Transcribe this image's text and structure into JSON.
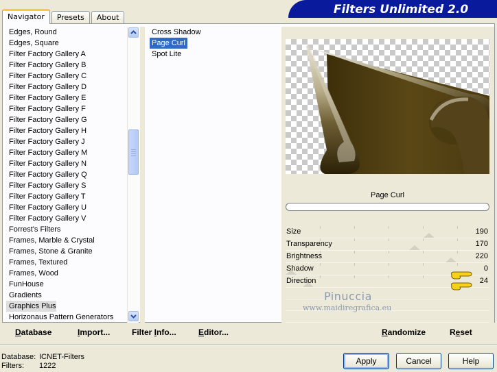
{
  "tabs": [
    {
      "label": "Navigator",
      "active": true
    },
    {
      "label": "Presets",
      "active": false
    },
    {
      "label": "About",
      "active": false
    }
  ],
  "banner": {
    "title": "Filters Unlimited 2.0"
  },
  "categories": {
    "items": [
      "Edges, Round",
      "Edges, Square",
      "Filter Factory Gallery A",
      "Filter Factory Gallery B",
      "Filter Factory Gallery C",
      "Filter Factory Gallery D",
      "Filter Factory Gallery E",
      "Filter Factory Gallery F",
      "Filter Factory Gallery G",
      "Filter Factory Gallery H",
      "Filter Factory Gallery J",
      "Filter Factory Gallery M",
      "Filter Factory Gallery N",
      "Filter Factory Gallery Q",
      "Filter Factory Gallery S",
      "Filter Factory Gallery T",
      "Filter Factory Gallery U",
      "Filter Factory Gallery V",
      "Forrest's Filters",
      "Frames, Marble & Crystal",
      "Frames, Stone & Granite",
      "Frames, Textured",
      "Frames, Wood",
      "FunHouse",
      "Gradients",
      "Graphics Plus",
      "Horizonaus Pattern Generators"
    ],
    "selected": "Graphics Plus"
  },
  "filters": {
    "items": [
      "Cross Shadow",
      "Page Curl",
      "Spot Lite"
    ],
    "selected": "Page Curl"
  },
  "preview": {
    "filter_name": "Page Curl",
    "progress": 0
  },
  "parameters": [
    {
      "label": "Size",
      "value": "190",
      "level": 190
    },
    {
      "label": "Transparency",
      "value": "170",
      "level": 170
    },
    {
      "label": "Brightness",
      "value": "220",
      "level": 220
    },
    {
      "label": "Shadow",
      "value": "0",
      "level": 0
    },
    {
      "label": "Direction",
      "value": "24",
      "level": 24
    }
  ],
  "watermark": {
    "name": "Pinuccia",
    "site": "www.maidiregrafica.eu"
  },
  "toolbar": {
    "database": {
      "pre": "",
      "u": "D",
      "post": "atabase"
    },
    "import": {
      "pre": "",
      "u": "I",
      "post": "mport..."
    },
    "filterinfo": {
      "pre": "Filter ",
      "u": "I",
      "post": "nfo..."
    },
    "editor": {
      "pre": "",
      "u": "E",
      "post": "ditor..."
    },
    "randomize": {
      "pre": "",
      "u": "R",
      "post": "andomize"
    },
    "reset": {
      "pre": "R",
      "u": "e",
      "post": "set"
    }
  },
  "status": {
    "database_label": "Database:",
    "database_value": "ICNET-Filters",
    "filters_label": "Filters:",
    "filters_value": "1222"
  },
  "buttons": {
    "apply": "Apply",
    "cancel": "Cancel",
    "help": "Help"
  },
  "colors": {
    "selection": "#316ac5",
    "banner": "#0a1a9c",
    "curl_dark": "#4a3a0e"
  }
}
